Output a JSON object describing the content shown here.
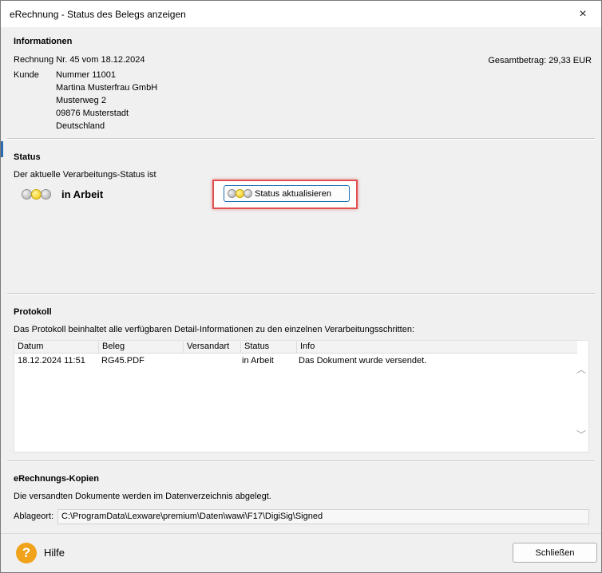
{
  "window": {
    "title": "eRechnung - Status des Belegs anzeigen"
  },
  "info": {
    "heading": "Informationen",
    "invoice_line": "Rechnung Nr. 45 vom 18.12.2024",
    "total": "Gesamtbetrag: 29,33 EUR",
    "customer_label": "Kunde",
    "customer_lines": [
      "Nummer  11001",
      "Martina Musterfrau GmbH",
      "Musterweg 2",
      "09876 Musterstadt",
      "Deutschland"
    ]
  },
  "status": {
    "heading": "Status",
    "description": "Der aktuelle Verarbeitungs-Status ist",
    "value": "in Arbeit",
    "refresh_button": "Status aktualisieren"
  },
  "protocol": {
    "heading": "Protokoll",
    "description": "Das Protokoll beinhaltet alle verfügbaren Detail-Informationen zu den einzelnen Verarbeitungsschritten:",
    "columns": [
      "Datum",
      "Beleg",
      "Versandart",
      "Status",
      "Info"
    ],
    "rows": [
      {
        "datum": "18.12.2024 11:51",
        "beleg": "RG45.PDF",
        "versandart": "",
        "status": "in Arbeit",
        "info": "Das Dokument wurde versendet."
      }
    ]
  },
  "copies": {
    "heading": "eRechnungs-Kopien",
    "description": "Die versandten Dokumente werden im Datenverzeichnis abgelegt.",
    "path_label": "Ablageort:",
    "path_value": "C:\\ProgramData\\Lexware\\premium\\Daten\\wawi\\F17\\DigiSig\\Signed"
  },
  "footer": {
    "help_label": "Hilfe",
    "help_icon_glyph": "?",
    "close_button": "Schließen"
  },
  "icons": {
    "close": "×",
    "scroll_up": "︿",
    "scroll_down": "﹀"
  },
  "colors": {
    "accent": "#1f6fb2",
    "highlight": "#e05050",
    "help": "#f0a21a"
  }
}
